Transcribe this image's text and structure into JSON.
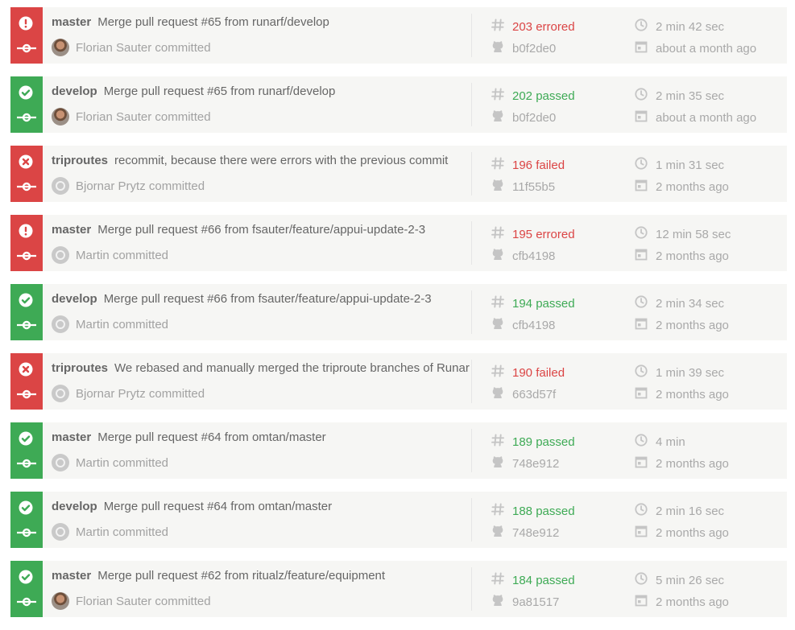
{
  "colors": {
    "passed": "#3eaa55",
    "failed": "#db4545",
    "errored": "#db4545"
  },
  "icons": {
    "passed": "check-circle-icon",
    "failed": "x-circle-icon",
    "errored": "exclamation-circle-icon",
    "commit": "commit-icon",
    "build_number": "hash-icon",
    "sha": "github-icon",
    "duration": "clock-icon",
    "finished": "calendar-icon"
  },
  "builds": [
    {
      "status": "errored",
      "branch": "master",
      "message": "Merge pull request #65 from runarf/develop",
      "committer": "Florian Sauter committed",
      "avatar": "photo",
      "build_label": "203 errored",
      "sha": "b0f2de0",
      "duration": "2 min 42 sec",
      "finished": "about a month ago"
    },
    {
      "status": "passed",
      "branch": "develop",
      "message": "Merge pull request #65 from runarf/develop",
      "committer": "Florian Sauter committed",
      "avatar": "photo",
      "build_label": "202 passed",
      "sha": "b0f2de0",
      "duration": "2 min 35 sec",
      "finished": "about a month ago"
    },
    {
      "status": "failed",
      "branch": "triproutes",
      "message": "recommit, because there were errors with the previous commit",
      "committer": "Bjornar Prytz committed",
      "avatar": "default",
      "build_label": "196 failed",
      "sha": "11f55b5",
      "duration": "1 min 31 sec",
      "finished": "2 months ago"
    },
    {
      "status": "errored",
      "branch": "master",
      "message": "Merge pull request #66 from fsauter/feature/appui-update-2-3",
      "committer": "Martin committed",
      "avatar": "default",
      "build_label": "195 errored",
      "sha": "cfb4198",
      "duration": "12 min 58 sec",
      "finished": "2 months ago"
    },
    {
      "status": "passed",
      "branch": "develop",
      "message": "Merge pull request #66 from fsauter/feature/appui-update-2-3",
      "committer": "Martin committed",
      "avatar": "default",
      "build_label": "194 passed",
      "sha": "cfb4198",
      "duration": "2 min 34 sec",
      "finished": "2 months ago"
    },
    {
      "status": "failed",
      "branch": "triproutes",
      "message": "We rebased and manually merged the triproute branches of Runar",
      "committer": "Bjornar Prytz committed",
      "avatar": "default",
      "build_label": "190 failed",
      "sha": "663d57f",
      "duration": "1 min 39 sec",
      "finished": "2 months ago"
    },
    {
      "status": "passed",
      "branch": "master",
      "message": "Merge pull request #64 from omtan/master",
      "committer": "Martin committed",
      "avatar": "default",
      "build_label": "189 passed",
      "sha": "748e912",
      "duration": "4 min",
      "finished": "2 months ago"
    },
    {
      "status": "passed",
      "branch": "develop",
      "message": "Merge pull request #64 from omtan/master",
      "committer": "Martin committed",
      "avatar": "default",
      "build_label": "188 passed",
      "sha": "748e912",
      "duration": "2 min 16 sec",
      "finished": "2 months ago"
    },
    {
      "status": "passed",
      "branch": "master",
      "message": "Merge pull request #62 from ritualz/feature/equipment",
      "committer": "Florian Sauter committed",
      "avatar": "photo",
      "build_label": "184 passed",
      "sha": "9a81517",
      "duration": "5 min 26 sec",
      "finished": "2 months ago"
    }
  ]
}
